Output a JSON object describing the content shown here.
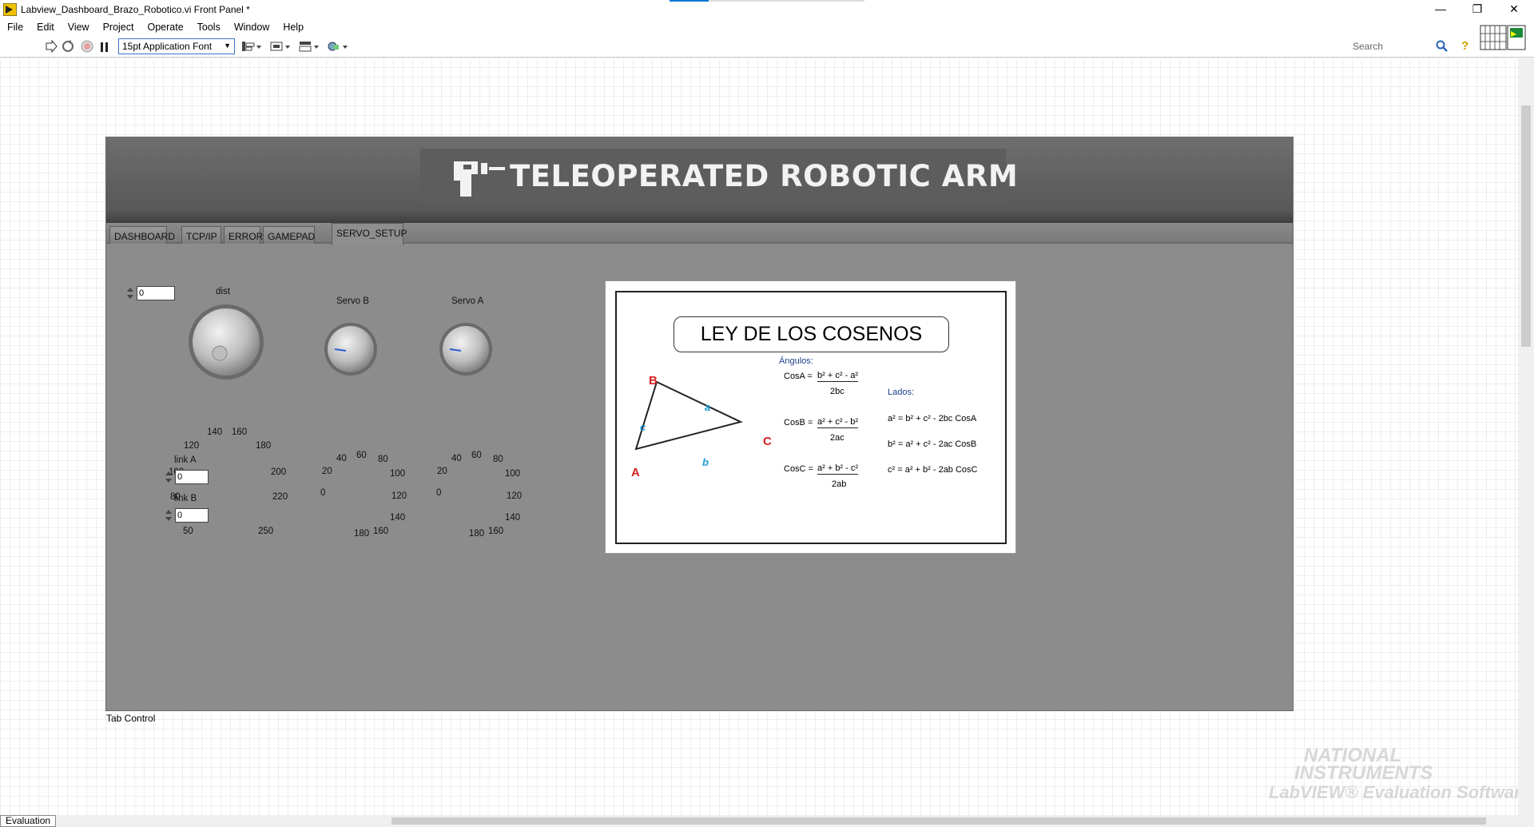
{
  "window": {
    "title": "Labview_Dashboard_Brazo_Robotico.vi Front Panel *",
    "minimize": "—",
    "restore": "❐",
    "close": "✕"
  },
  "menu": [
    "File",
    "Edit",
    "View",
    "Project",
    "Operate",
    "Tools",
    "Window",
    "Help"
  ],
  "toolbar": {
    "font_select": "15pt Application Font",
    "search_placeholder": "Search",
    "help": "?"
  },
  "banner": {
    "title": "TELEOPERATED ROBOTIC ARM"
  },
  "tabs": [
    {
      "label": "DASHBOARD"
    },
    {
      "label": "TCP/IP"
    },
    {
      "label": "ERROR"
    },
    {
      "label": "GAMEPAD"
    },
    {
      "label": "SERVO_SETUP",
      "active": true
    }
  ],
  "tab_control_label": "Tab Control",
  "controls": {
    "dist": {
      "label": "dist",
      "value": "0",
      "ticks": [
        "50",
        "80",
        "100",
        "120",
        "140",
        "160",
        "180",
        "200",
        "220",
        "250"
      ],
      "knob_value": 80
    },
    "servo_b": {
      "label": "Servo B",
      "ticks": [
        "0",
        "20",
        "40",
        "60",
        "80",
        "100",
        "120",
        "140",
        "160",
        "180"
      ],
      "knob_value": 0
    },
    "servo_a": {
      "label": "Servo A",
      "ticks": [
        "0",
        "20",
        "40",
        "60",
        "80",
        "100",
        "120",
        "140",
        "160",
        "180"
      ],
      "knob_value": 0
    },
    "link_a": {
      "label": "link A",
      "value": "0"
    },
    "link_b": {
      "label": "link B",
      "value": "0"
    }
  },
  "board": {
    "title": "LEY DE LOS COSENOS",
    "angles_label": "Ángulos:",
    "sides_label": "Lados:",
    "vertex_a": "A",
    "vertex_b": "B",
    "vertex_c": "C",
    "side_a": "a",
    "side_b": "b",
    "side_c": "c",
    "cosA_lhs": "CosA =",
    "cosA_num": "b² + c² - a²",
    "cosA_den": "2bc",
    "cosB_lhs": "CosB =",
    "cosB_num": "a² + c² - b²",
    "cosB_den": "2ac",
    "cosC_lhs": "CosC =",
    "cosC_num": "a² + b² - c²",
    "cosC_den": "2ab",
    "side_eq_a": "a² = b² + c² - 2bc CosA",
    "side_eq_b": "b² = a² + c² - 2ac CosB",
    "side_eq_c": "c² = a² + b² - 2ab CosC"
  },
  "status": {
    "evaluation": "Evaluation"
  },
  "watermark": {
    "line1": "NATIONAL",
    "line2": "INSTRUMENTS",
    "line3": "LabVIEW® Evaluation Software"
  },
  "colors": {
    "accent_blue": "#0a76d6",
    "panel_gray": "#8c8c8c",
    "vertex_red": "#d42020",
    "side_blue": "#1a9ad8"
  }
}
